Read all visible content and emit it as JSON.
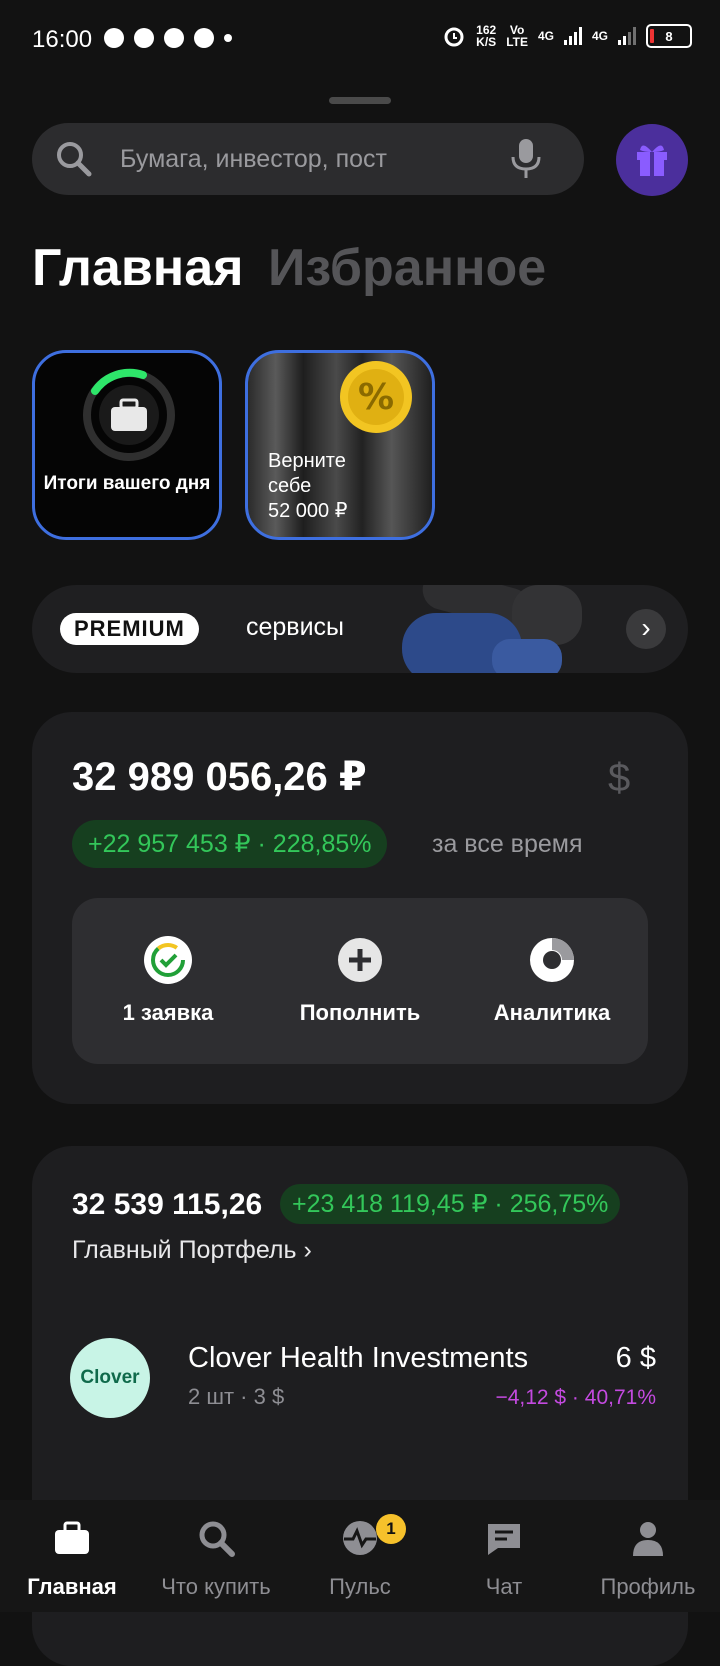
{
  "status_bar": {
    "time": "16:00",
    "net_speed_value": "162",
    "net_speed_unit": "K/S",
    "volte_top": "Vo",
    "volte_bottom": "LTE",
    "sim1": "4G",
    "sim2": "4G",
    "battery": "8"
  },
  "search": {
    "placeholder": "Бумага, инвестор, пост"
  },
  "tabs": [
    {
      "label": "Главная",
      "active": true
    },
    {
      "label": "Избранное",
      "active": false
    }
  ],
  "stories": [
    {
      "label": "Итоги вашего дня"
    },
    {
      "label_lines": [
        "Верните",
        "себе",
        "52 000 ₽"
      ]
    }
  ],
  "premium": {
    "badge": "PREMIUM",
    "text": "сервисы"
  },
  "portfolio": {
    "total": "32 989 056,26 ₽",
    "currency_symbol": "$",
    "gain": "+22 957 453 ₽ · 228,85%",
    "gain_period": "за все время",
    "actions": [
      {
        "label": "1 заявка",
        "icon": "order-check-icon"
      },
      {
        "label": "Пополнить",
        "icon": "plus-icon"
      },
      {
        "label": "Аналитика",
        "icon": "analytics-donut-icon"
      }
    ]
  },
  "main_portfolio": {
    "total": "32 539 115,26",
    "gain": "+23 418 119,45 ₽ · 256,75%",
    "name": "Главный Портфель ›",
    "securities": [
      {
        "logo_text": "Clover",
        "name": "Clover Health Investments",
        "sub": "2 шт · 3 $",
        "value": "6 $",
        "change": "−4,12 $ · 40,71%"
      }
    ]
  },
  "nav": [
    {
      "label": "Главная",
      "icon": "briefcase-icon",
      "active": true
    },
    {
      "label": "Что купить",
      "icon": "search-icon",
      "active": false
    },
    {
      "label": "Пульс",
      "icon": "pulse-icon",
      "active": false,
      "badge": "1"
    },
    {
      "label": "Чат",
      "icon": "chat-icon",
      "active": false
    },
    {
      "label": "Профиль",
      "icon": "profile-icon",
      "active": false
    }
  ],
  "colors": {
    "background": "#121212",
    "accent_green": "#33c75a",
    "accent_purple": "#c44ae0",
    "story_border": "#3e6fe0"
  }
}
